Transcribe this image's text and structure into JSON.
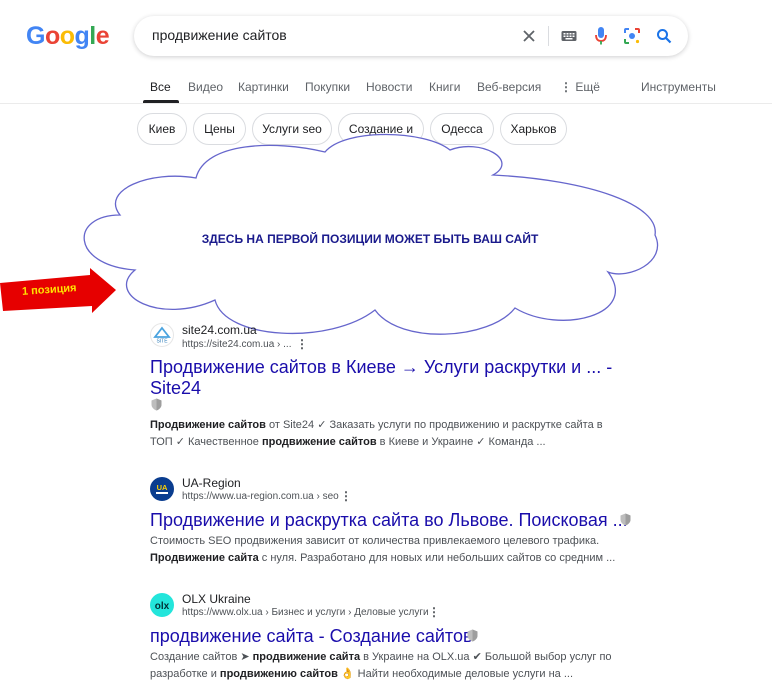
{
  "logo": [
    "G",
    "o",
    "o",
    "g",
    "l",
    "e"
  ],
  "logo_colors": [
    "#4285F4",
    "#EA4335",
    "#FBBC05",
    "#4285F4",
    "#34A853",
    "#EA4335"
  ],
  "search": {
    "query": "продвижение сайтов"
  },
  "tabs": [
    {
      "label": "Все"
    },
    {
      "label": "Видео"
    },
    {
      "label": "Картинки"
    },
    {
      "label": "Покупки"
    },
    {
      "label": "Новости"
    },
    {
      "label": "Книги"
    },
    {
      "label": "Веб-версия"
    },
    {
      "label": "Ещё"
    },
    {
      "label": "Инструменты"
    }
  ],
  "chips": [
    "Киев",
    "Цены",
    "Услуги seo",
    "Создание и",
    "Одесса",
    "Харьков"
  ],
  "promo": {
    "cloud_text": "ЗДЕСЬ НА ПЕРВОЙ ПОЗИЦИИ МОЖЕТ БЫТЬ ВАШ САЙТ",
    "arrow_text": "1 позиция",
    "cloud_stroke": "#6666cc",
    "arrow_color": "#e60000"
  },
  "results": [
    {
      "site": "site24.com.ua",
      "url": "https://site24.com.ua › ...",
      "title_line1": "Продвижение сайтов в Киеве → Услуги раскрутки и ... -",
      "title_line2": "Site24",
      "snippet1_b1": "Продвижение сайтов",
      "snippet1_t1": " от Site24 ✓ Заказать услуги по продвижению и раскрутке сайта в",
      "snippet2_t1": "ТОП ✓ Качественное ",
      "snippet2_b1": "продвижение сайтов",
      "snippet2_t2": " в Киеве и Украине ✓ Команда ..."
    },
    {
      "site": "UA-Region",
      "url": "https://www.ua-region.com.ua › seo",
      "title_line1": "Продвижение и раскрутка сайта во Львове. Поисковая ...",
      "snippet1_t1": "Стоимость SEO продвижения зависит от количества привлекаемого целевого трафика.",
      "snippet2_b1": "Продвижение сайта",
      "snippet2_t2": " с нуля. Разработано для новых или небольших сайтов со средним ..."
    },
    {
      "site": "OLX Ukraine",
      "url": "https://www.olx.ua › Бизнес и услуги › Деловые услуги",
      "title_line1": "продвижение сайта - Создание сайтов",
      "snippet1_t1": "Создание сайтов ➤ ",
      "snippet1_b1": "продвижение сайта",
      "snippet1_t2": " в Украине на OLX.ua ✔ Большой выбор услуг по",
      "snippet2_t1": "разработке и ",
      "snippet2_b1": "продвижению сайтов",
      "snippet2_t2": " 👌 Найти необходимые деловые услуги на ..."
    }
  ]
}
